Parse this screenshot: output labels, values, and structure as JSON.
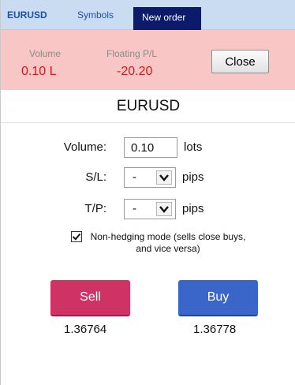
{
  "tabs": [
    {
      "label": "EURUSD"
    },
    {
      "label": "Symbols"
    },
    {
      "label": "New order"
    }
  ],
  "status": {
    "volume_label": "Volume",
    "volume_value": "0.10 L",
    "pl_label": "Floating P/L",
    "pl_value": "-20.20",
    "close_label": "Close"
  },
  "symbol": "EURUSD",
  "form": {
    "volume_label": "Volume:",
    "volume_value": "0.10",
    "volume_unit": "lots",
    "sl_label": "S/L:",
    "sl_value": "-",
    "sl_unit": "pips",
    "tp_label": "T/P:",
    "tp_value": "-",
    "tp_unit": "pips",
    "hedging_checked": true,
    "hedging_text": "Non-hedging mode (sells close buys, and vice versa)"
  },
  "actions": {
    "sell_label": "Sell",
    "sell_price": "1.36764",
    "buy_label": "Buy",
    "buy_price": "1.36778"
  },
  "colors": {
    "status_bg": "#f9c6c6",
    "pl_red": "#d9161c",
    "sell": "#cf3366",
    "buy": "#3a66c9",
    "active_tab": "#0b1a6b"
  }
}
